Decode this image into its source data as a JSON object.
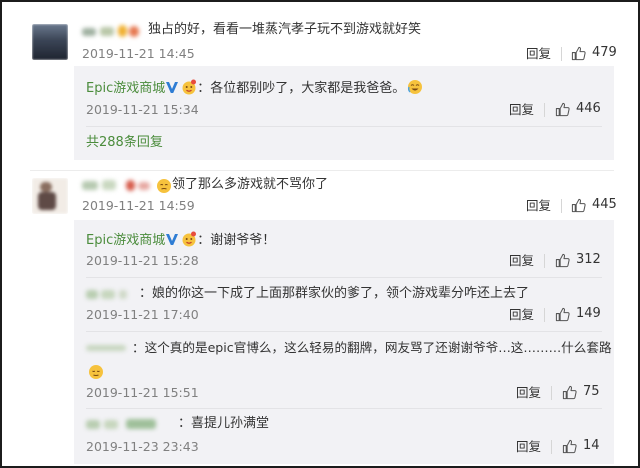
{
  "comments": [
    {
      "text": "独占的好，看看一堆蒸汽孝子玩不到游戏就好笑",
      "time": "2019-11-21 14:45",
      "reply_label": "回复",
      "likes": "479",
      "replies": [
        {
          "name": "Epic游戏商城",
          "text": "：各位都别吵了，大家都是我爸爸。",
          "time": "2019-11-21 15:34",
          "reply_label": "回复",
          "likes": "446"
        }
      ],
      "more_replies": "共288条回复"
    },
    {
      "text": "领了那么多游戏就不骂你了",
      "time": "2019-11-21 14:59",
      "reply_label": "回复",
      "likes": "445",
      "replies": [
        {
          "name": "Epic游戏商城",
          "text": "：谢谢爷爷！",
          "time": "2019-11-21 15:28",
          "reply_label": "回复",
          "likes": "312"
        },
        {
          "name": "",
          "text": "：娘的你这一下成了上面那群家伙的爹了，领个游戏辈分咋还上去了",
          "time": "2019-11-21 17:40",
          "reply_label": "回复",
          "likes": "149"
        },
        {
          "name": "",
          "text": "：这个真的是epic官博么，这么轻易的翻牌，网友骂了还谢谢爷爷…这………什么套路",
          "time": "2019-11-21 15:51",
          "reply_label": "回复",
          "likes": "75"
        },
        {
          "name": "",
          "text": "：喜提儿孙满堂",
          "time": "2019-11-23 23:43",
          "reply_label": "回复",
          "likes": "14"
        }
      ]
    }
  ],
  "colors": {
    "verified": "#2f7dd4",
    "epic_name": "#4b8c3c",
    "panel_bg": "#f2f2f5",
    "time": "#808080"
  },
  "icons": [
    "thumbs-up-icon",
    "verified-v-icon",
    "emoji-face-icon"
  ]
}
